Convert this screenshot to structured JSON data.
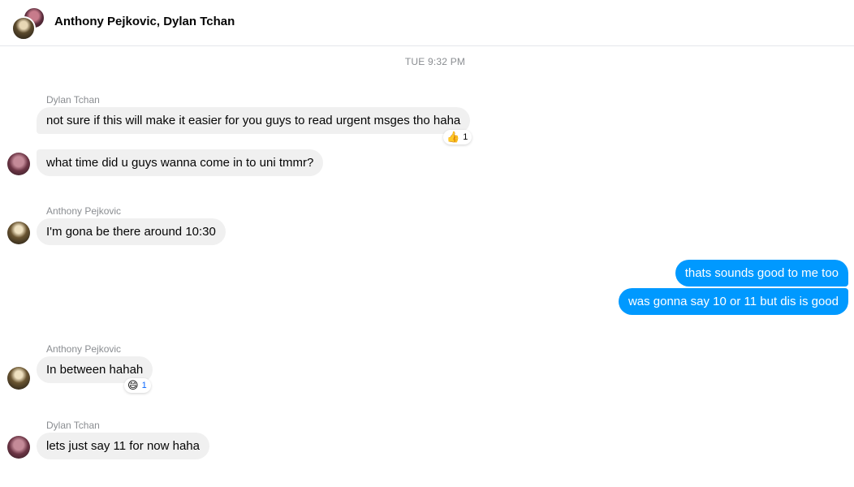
{
  "header": {
    "title": "Anthony Pejkovic, Dylan Tchan"
  },
  "timestamp": "TUE 9:32 PM",
  "messages": [
    {
      "sender": "Dylan Tchan",
      "text": "not sure if this will make it easier for you guys to read urgent msges tho haha",
      "reaction": {
        "emoji": "👍",
        "count": "1"
      }
    },
    {
      "text": "what time did u guys wanna come in to uni tmmr?"
    },
    {
      "sender": "Anthony Pejkovic",
      "text": "I'm gona be there around 10:30"
    },
    {
      "text": "thats sounds good to me too"
    },
    {
      "text": "was gonna say 10 or 11 but dis is good"
    },
    {
      "sender": "Anthony Pejkovic",
      "text": "In between hahah",
      "reaction": {
        "emoji": "😄",
        "count": "1"
      }
    },
    {
      "sender": "Dylan Tchan",
      "text": "lets just say 11 for now haha"
    }
  ],
  "colors": {
    "outgoing": "#0099ff",
    "incoming": "#f0f0f0",
    "meta": "#8a8d91"
  },
  "icons": {
    "reaction_like": "thumbs-up-icon",
    "reaction_laugh": "laughing-face-icon"
  }
}
